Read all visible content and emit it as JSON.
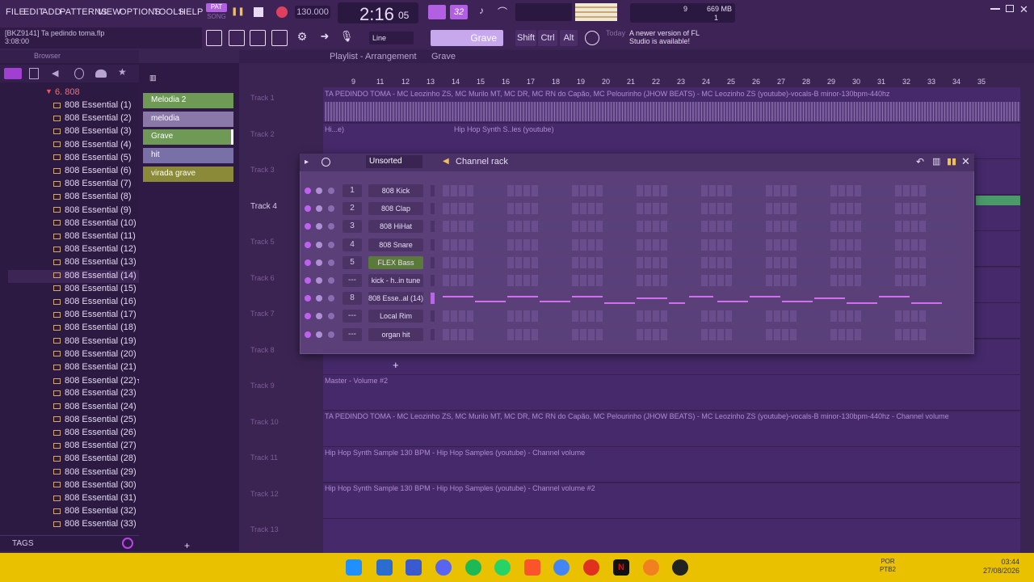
{
  "menu": [
    "FILE",
    "EDIT",
    "ADD",
    "PATTERNS",
    "VIEW",
    "OPTIONS",
    "TOOLS",
    "HELP"
  ],
  "transport": {
    "pat_label": "PAT",
    "song_label": "SONG",
    "tempo": "130.000",
    "time": "2:16",
    "time_sub": "05",
    "pattern_num": "32"
  },
  "meter": {
    "cpu": "9",
    "memory": "669 MB",
    "voices": "1"
  },
  "hint": {
    "project": "[BKZ9141] Ta pedindo toma.flp",
    "time": "3:08:00"
  },
  "toolbar": {
    "snap": "Line",
    "pattern": "Grave",
    "shift": "Shift",
    "ctrl": "Ctrl",
    "alt": "Alt",
    "notice_title": "Today",
    "notice_text": "A newer version of FL Studio is available!"
  },
  "browser": {
    "title": "Browser",
    "folder": "6. 808",
    "tags": "TAGS",
    "items": [
      "808 Essential (1)",
      "808 Essential (2)",
      "808 Essential (3)",
      "808 Essential (4)",
      "808 Essential (5)",
      "808 Essential (6)",
      "808 Essential (7)",
      "808 Essential (8)",
      "808 Essential (9)",
      "808 Essential (10)",
      "808 Essential (11)",
      "808 Essential (12)",
      "808 Essential (13)",
      "808 Essential (14)",
      "808 Essential (15)",
      "808 Essential (16)",
      "808 Essential (17)",
      "808 Essential (18)",
      "808 Essential (19)",
      "808 Essential (20)",
      "808 Essential (21)",
      "808 Essential (22)★",
      "808 Essential (23)",
      "808 Essential (24)",
      "808 Essential (25)",
      "808 Essential (26)",
      "808 Essential (27)",
      "808 Essential (28)",
      "808 Essential (29)",
      "808 Essential (30)",
      "808 Essential (31)",
      "808 Essential (32)",
      "808 Essential (33)"
    ]
  },
  "patterns": [
    "Melodia 2",
    "melodia",
    "Grave",
    "hit",
    "virada grave"
  ],
  "playlist": {
    "title": "Playlist - Arrangement",
    "crumb": "Grave",
    "ruler": [
      "9",
      "11",
      "12",
      "13",
      "14",
      "15",
      "16",
      "17",
      "18",
      "19",
      "20",
      "21",
      "22",
      "23",
      "24",
      "25",
      "26",
      "27",
      "28",
      "29",
      "30",
      "31",
      "32",
      "33",
      "34",
      "35"
    ],
    "tracks": [
      "Track 1",
      "Track 2",
      "Track 3",
      "Track 4",
      "Track 5",
      "Track 6",
      "Track 7",
      "Track 8",
      "Track 9",
      "Track 10",
      "Track 11",
      "Track 12",
      "Track 13"
    ],
    "clip1": "TA PEDINDO TOMA - MC Leozinho ZS, MC Murilo MT, MC DR, MC RN do Capão, MC Pelourinho (JHOW BEATS) - MC Leozinho ZS (youtube)-vocals-B minor-130bpm-440hz",
    "clip2a": "Hi...e)",
    "clip2b": "Hip Hop Synth S..les (youtube)",
    "clip9": "Master - Volume #2",
    "clip10": "TA PEDINDO TOMA - MC Leozinho ZS, MC Murilo MT, MC DR, MC RN do Capão, MC Pelourinho (JHOW BEATS) - MC Leozinho ZS (youtube)-vocals-B minor-130bpm-440hz - Channel volume",
    "clip11": "Hip Hop Synth Sample 130 BPM - Hip Hop Samples (youtube) - Channel volume",
    "clip12": "Hip Hop Synth Sample 130 BPM - Hip Hop Samples (youtube) - Channel volume #2"
  },
  "rack": {
    "title": "Channel rack",
    "filter": "Unsorted",
    "channels": [
      {
        "num": "1",
        "name": "808 Kick"
      },
      {
        "num": "2",
        "name": "808 Clap"
      },
      {
        "num": "3",
        "name": "808 HiHat"
      },
      {
        "num": "4",
        "name": "808 Snare"
      },
      {
        "num": "5",
        "name": "FLEX Bass"
      },
      {
        "num": "---",
        "name": "kick - h..in tune"
      },
      {
        "num": "8",
        "name": "808 Esse..al (14)"
      },
      {
        "num": "---",
        "name": "Local Rim"
      },
      {
        "num": "---",
        "name": "organ hit"
      }
    ]
  },
  "tray": {
    "lang": "POR",
    "layout": "PTB2",
    "time": "03:44",
    "date": "27/08/2026"
  }
}
